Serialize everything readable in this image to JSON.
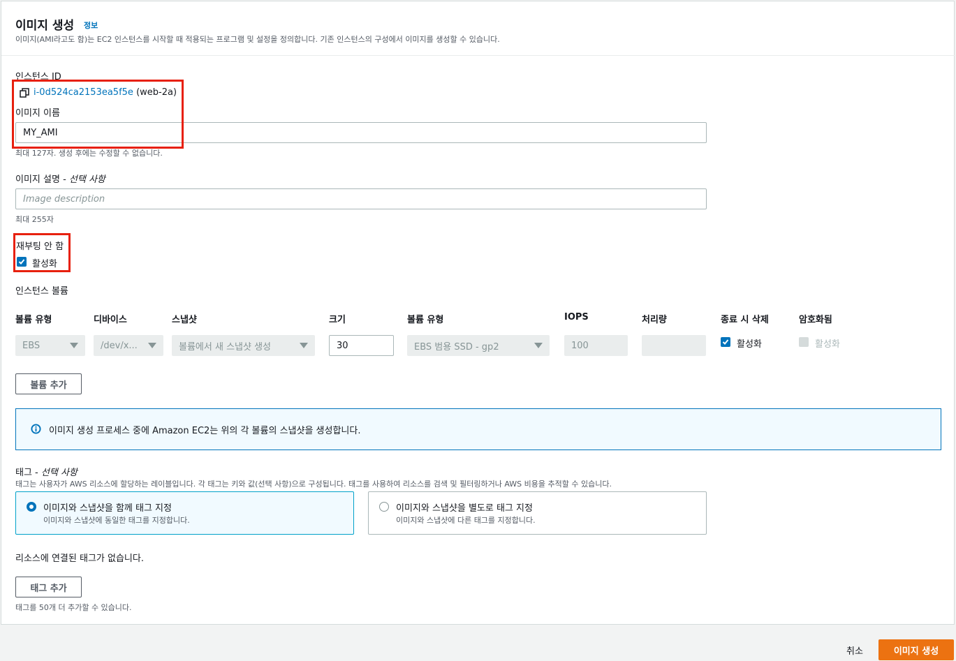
{
  "header": {
    "title": "이미지 생성",
    "info_link": "정보",
    "description": "이미지(AMI라고도 함)는 EC2 인스턴스를 시작할 때 적용되는 프로그램 및 설정을 정의합니다. 기존 인스턴스의 구성에서 이미지를 생성할 수 있습니다."
  },
  "instance": {
    "label": "인스턴스 ID",
    "id": "i-0d524ca2153ea5f5e",
    "name": "(web-2a)"
  },
  "image_name": {
    "label": "이미지 이름",
    "value": "MY_AMI",
    "hint": "최대 127자. 생성 후에는 수정할 수 없습니다."
  },
  "image_desc": {
    "label": "이미지 설명 -",
    "label_optional": "선택 사항",
    "placeholder": "Image description",
    "hint": "최대 255자"
  },
  "no_reboot": {
    "label": "재부팅 안 함",
    "checkbox_label": "활성화",
    "checked": true
  },
  "volumes": {
    "section_label": "인스턴스 볼륨",
    "columns": [
      "볼륨 유형",
      "디바이스",
      "스냅샷",
      "크기",
      "볼륨 유형",
      "IOPS",
      "처리량",
      "종료 시 삭제",
      "암호화됨"
    ],
    "row": {
      "volume_type": "EBS",
      "device": "/dev/x...",
      "snapshot": "볼륨에서 새 스냅샷 생성",
      "size": "30",
      "ebs_type": "EBS 범용 SSD - gp2",
      "iops": "100",
      "throughput": "",
      "delete_on_termination": "활성화",
      "encrypted": "활성화"
    },
    "add_button": "볼륨 추가"
  },
  "alert": {
    "text": "이미지 생성 프로세스 중에 Amazon EC2는 위의 각 볼륨의 스냅샷을 생성합니다."
  },
  "tags": {
    "label": "태그 -",
    "label_optional": "선택 사항",
    "description": "태그는 사용자가 AWS 리소스에 할당하는 레이블입니다. 각 태그는 키와 값(선택 사항)으로 구성됩니다. 태그를 사용하여 리소스를 검색 및 필터링하거나 AWS 비용을 추적할 수 있습니다.",
    "options": [
      {
        "title": "이미지와 스냅샷을 함께 태그 지정",
        "desc": "이미지와 스냅샷에 동일한 태그를 지정합니다.",
        "selected": true
      },
      {
        "title": "이미지와 스냅샷을 별도로 태그 지정",
        "desc": "이미지와 스냅샷에 다른 태그를 지정합니다.",
        "selected": false
      }
    ],
    "empty_text": "리소스에 연결된 태그가 없습니다.",
    "add_button": "태그 추가",
    "limit_hint": "태그를 50개 더 추가할 수 있습니다."
  },
  "footer": {
    "cancel": "취소",
    "submit": "이미지 생성"
  },
  "colors": {
    "primary": "#ec7211",
    "link": "#0073bb",
    "highlight": "#e7200e"
  }
}
